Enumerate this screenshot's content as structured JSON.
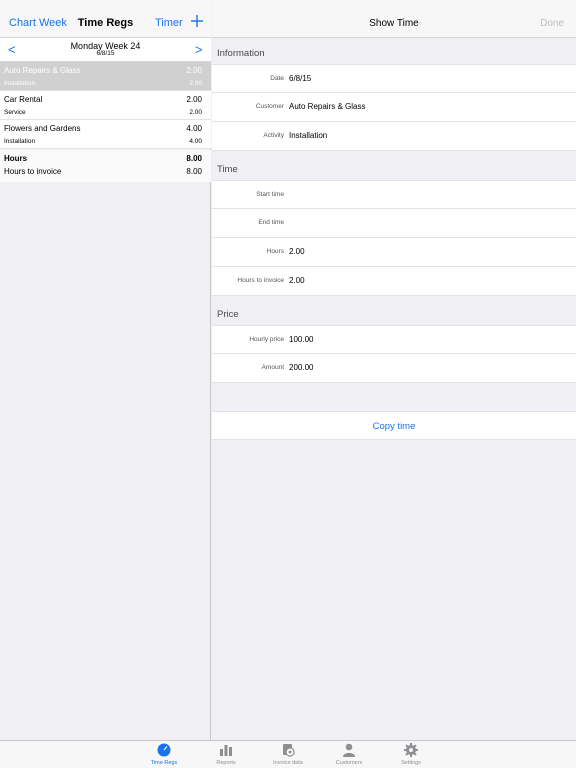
{
  "colors": {
    "accent": "#1a73e8",
    "selected_row": "#d0d0d0",
    "disabled": "#bdbdc2",
    "inactive_tab": "#8e8e93"
  },
  "left": {
    "nav": {
      "chart_label": "Chart",
      "week_label": "Week",
      "title": "Time Regs",
      "timer_label": "Timer",
      "add_icon": "plus-icon"
    },
    "date_bar": {
      "prev": "<",
      "next": ">",
      "title": "Monday Week 24",
      "date": "6/8/15"
    },
    "entries": [
      {
        "customer": "Auto Repairs & Glass",
        "activity": "Installation",
        "hours": "2.00",
        "hours_invoice": "2.00",
        "selected": true
      },
      {
        "customer": "Car Rental",
        "activity": "Service",
        "hours": "2.00",
        "hours_invoice": "2.00",
        "selected": false
      },
      {
        "customer": "Flowers and Gardens",
        "activity": "Installation",
        "hours": "4.00",
        "hours_invoice": "4.00",
        "selected": false
      }
    ],
    "totals": {
      "hours_label": "Hours",
      "hours_value": "8.00",
      "invoice_label": "Hours to invoice",
      "invoice_value": "8.00"
    }
  },
  "right": {
    "nav": {
      "title": "Show Time",
      "done_label": "Done"
    },
    "sections": {
      "information": {
        "header": "Information",
        "date_label": "Date",
        "date_value": "6/8/15",
        "customer_label": "Customer",
        "customer_value": "Auto Repairs & Glass",
        "activity_label": "Activity",
        "activity_value": "Installation"
      },
      "time": {
        "header": "Time",
        "start_label": "Start time",
        "start_value": "",
        "end_label": "End time",
        "end_value": "",
        "hours_label": "Hours",
        "hours_value": "2.00",
        "invoice_label": "Hours to invoice",
        "invoice_value": "2.00"
      },
      "price": {
        "header": "Price",
        "hourly_label": "Hourly price",
        "hourly_value": "100.00",
        "amount_label": "Amount",
        "amount_value": "200.00"
      }
    },
    "copy_label": "Copy time"
  },
  "tabbar": {
    "tabs": [
      {
        "label": "Time Regs",
        "icon": "clock-icon",
        "active": true
      },
      {
        "label": "Reports",
        "icon": "bar-chart-icon",
        "active": false
      },
      {
        "label": "Invoice data",
        "icon": "invoice-icon",
        "active": false
      },
      {
        "label": "Customers",
        "icon": "person-icon",
        "active": false
      },
      {
        "label": "Settings",
        "icon": "gear-icon",
        "active": false
      }
    ]
  }
}
